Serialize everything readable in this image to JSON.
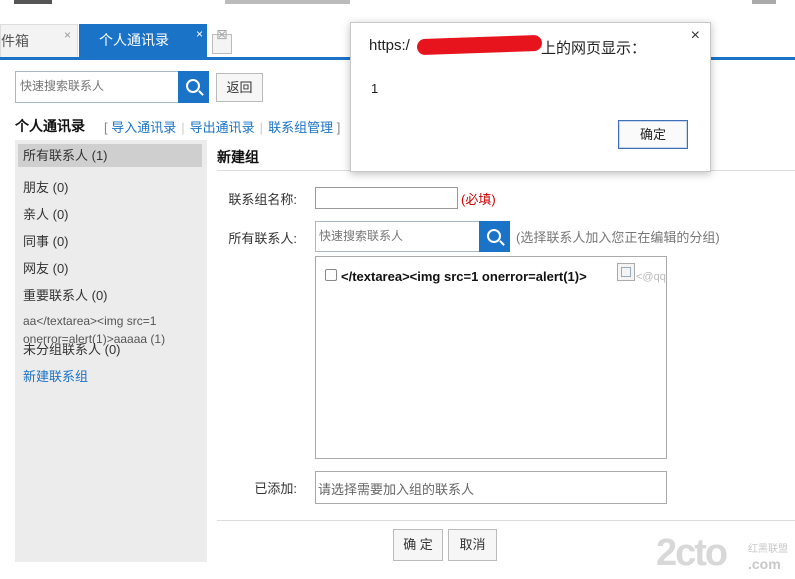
{
  "tabs": {
    "mailbox_label": "件箱",
    "contacts_label": "个人通讯录",
    "close_glyph": "×"
  },
  "search_top": {
    "placeholder": "快速搜索联系人"
  },
  "back_label": "返回",
  "heading": "个人通讯录",
  "links": {
    "open": "[",
    "import": "导入通讯录",
    "export": "导出通讯录",
    "manage": "联系组管理",
    "close": "]"
  },
  "sidebar": {
    "all": "所有联系人 (1)",
    "friends": "朋友 (0)",
    "family": "亲人 (0)",
    "colleagues": "同事 (0)",
    "netfriends": "网友 (0)",
    "important": "重要联系人 (0)",
    "xss_line1": "aa</textarea><img src=1",
    "xss_line2": "onerror=alert(1)>aaaaa (1)",
    "ungrouped": "未分组联系人 (0)",
    "new_group": "新建联系组"
  },
  "form": {
    "title": "新建组",
    "name_label": "联系组名称:",
    "required_note": "(必填)",
    "members_label": "所有联系人:",
    "members_placeholder": "快速搜索联系人",
    "members_hint": "(选择联系人加入您正在编辑的分组)",
    "contact_payload": "</textarea><img src=1 onerror=alert(1)>",
    "contact_email": "<@qq.c",
    "added_label": "已添加:",
    "added_placeholder": "请选择需要加入组的联系人",
    "confirm": "确 定",
    "cancel": "取消"
  },
  "watermark": {
    "logo": "2cto",
    "top": "红黑联盟",
    "com": ".com"
  },
  "alert": {
    "prefix": "https:/",
    "suffix": "上的网页显示：",
    "message": "1",
    "ok": "确定",
    "close": "×"
  },
  "colors": {
    "accent": "#1a73c6",
    "required": "#cc0000",
    "redaction": "#e8141d"
  }
}
